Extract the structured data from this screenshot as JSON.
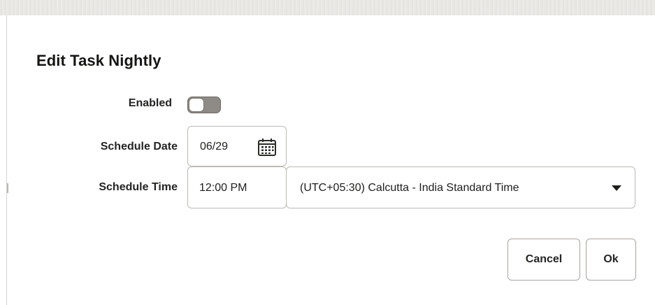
{
  "dialog": {
    "title": "Edit Task Nightly"
  },
  "form": {
    "enabled": {
      "label": "Enabled",
      "value": false
    },
    "schedule_date": {
      "label": "Schedule Date",
      "value": "06/29",
      "icon": "calendar-icon"
    },
    "schedule_time": {
      "label": "Schedule Time",
      "value": "12:00 PM"
    },
    "timezone": {
      "selected": "(UTC+05:30) Calcutta - India Standard Time",
      "icon": "chevron-down-icon"
    }
  },
  "actions": {
    "cancel_label": "Cancel",
    "ok_label": "Ok"
  },
  "colors": {
    "toggle_off": "#8e8a85",
    "border": "#bdbab6",
    "text": "#161513"
  }
}
